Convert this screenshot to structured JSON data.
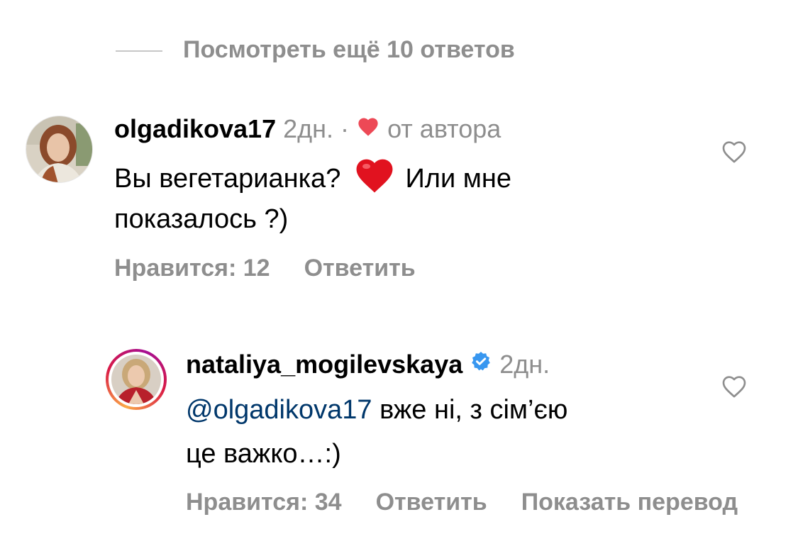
{
  "view_more": {
    "label": "Посмотреть ещё 10 ответов"
  },
  "comments": [
    {
      "username": "olgadikova17",
      "time": "2дн.",
      "separator": "·",
      "author_like_label": "от автора",
      "body_line1_a": "Вы вегетарианка?",
      "body_line1_b": "Или мне",
      "body_line2": "показалось ?)",
      "likes": "Нравится: 12",
      "reply": "Ответить"
    },
    {
      "username": "nataliya_mogilevskaya",
      "time": "2дн.",
      "mention": "@olgadikova17",
      "body_line1": " вже ні, з сім’єю",
      "body_line2": "це важко…:)",
      "likes": "Нравится: 34",
      "reply": "Ответить",
      "translate": "Показать перевод"
    }
  ],
  "icons": {
    "like": "heart-outline-icon",
    "author_like": "heart-filled-icon",
    "emoji": "red-heart-emoji",
    "verified": "verified-badge-icon"
  },
  "colors": {
    "muted": "#8e8e8e",
    "mention": "#00376b",
    "heart": "#ed4956",
    "verified": "#3897f0"
  }
}
